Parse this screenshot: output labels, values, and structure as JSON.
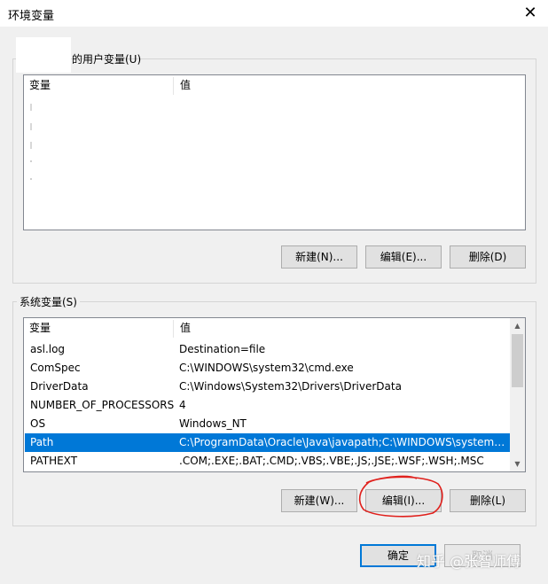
{
  "window": {
    "title": "环境变量",
    "close_glyph": "✕"
  },
  "user_vars": {
    "group_label": "的用户变量(U)",
    "headers": [
      "变量",
      "值"
    ],
    "buttons": {
      "new": "新建(N)...",
      "edit": "编辑(E)...",
      "delete": "删除(D)"
    }
  },
  "system_vars": {
    "group_label": "系统变量(S)",
    "headers": [
      "变量",
      "值"
    ],
    "rows": [
      {
        "name": "asl.log",
        "value": "Destination=file"
      },
      {
        "name": "ComSpec",
        "value": "C:\\WINDOWS\\system32\\cmd.exe"
      },
      {
        "name": "DriverData",
        "value": "C:\\Windows\\System32\\Drivers\\DriverData"
      },
      {
        "name": "NUMBER_OF_PROCESSORS",
        "value": "4"
      },
      {
        "name": "OS",
        "value": "Windows_NT"
      },
      {
        "name": "Path",
        "value": "C:\\ProgramData\\Oracle\\Java\\javapath;C:\\WINDOWS\\system3..."
      },
      {
        "name": "PATHEXT",
        "value": ".COM;.EXE;.BAT;.CMD;.VBS;.VBE;.JS;.JSE;.WSF;.WSH;.MSC"
      }
    ],
    "selected_row": "Path",
    "buttons": {
      "new": "新建(W)...",
      "edit": "编辑(I)...",
      "delete": "删除(L)"
    }
  },
  "footer": {
    "ok": "确定",
    "cancel": "取消"
  },
  "watermark": "知乎 @张智师傅",
  "colors": {
    "selection": "#0078d7",
    "annotation": "#e0201c"
  }
}
